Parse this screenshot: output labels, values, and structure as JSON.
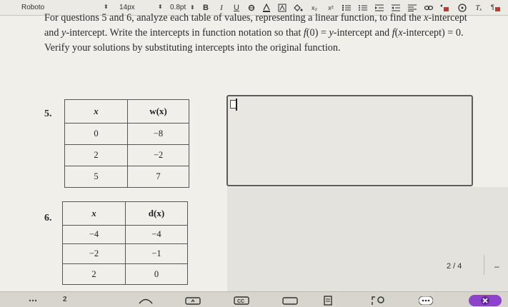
{
  "toolbar": {
    "font_name": "Roboto",
    "font_size": "14px",
    "line_spacing": "0.8pt",
    "bold_label": "B",
    "italic_label": "I",
    "underline_label": "U",
    "subscript_label": "x₂",
    "superscript_label": "x²",
    "clear_format_label": "Tₓ"
  },
  "instructions": {
    "text_html": "For questions 5 and 6, analyze each table of values, representing a linear function, to find the <i>x</i>-intercept and <i>y</i>-intercept. Write the intercepts in function notation so that <i>f</i>(0) = <i>y</i>-intercept and <i>f</i>(<i>x</i>-intercept) = 0. Verify your solutions by substituting intercepts into the original function."
  },
  "question5": {
    "number": "5.",
    "headers": [
      "x",
      "w(x)"
    ],
    "rows": [
      [
        "0",
        "−8"
      ],
      [
        "2",
        "−2"
      ],
      [
        "5",
        "7"
      ]
    ]
  },
  "question6": {
    "number": "6.",
    "headers": [
      "x",
      "d(x)"
    ],
    "rows": [
      [
        "−4",
        "−4"
      ],
      [
        "−2",
        "−1"
      ],
      [
        "2",
        "0"
      ]
    ]
  },
  "pager": {
    "label": "2 / 4",
    "dash": "–"
  },
  "taskbar": {
    "badge_number": "2",
    "cc_label": "CC"
  },
  "colors": {
    "accent": "#8e44c9",
    "close_button": "#6f3bb0"
  }
}
